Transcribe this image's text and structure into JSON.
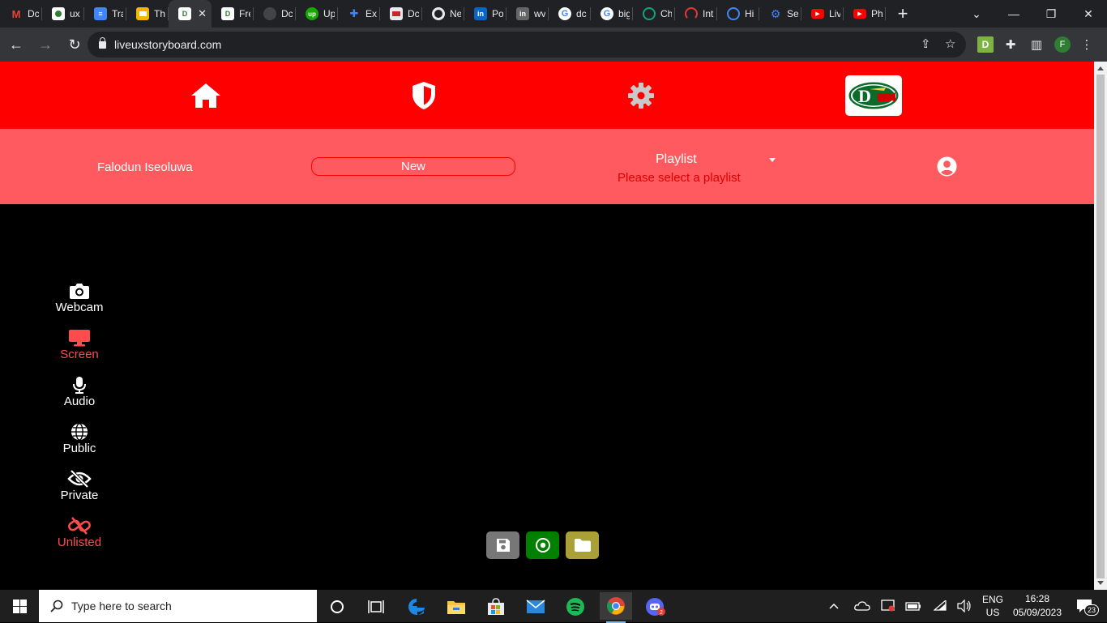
{
  "browser": {
    "tabs": [
      {
        "icon": "gmail-icon",
        "title": "Dc",
        "color": "#ea4335"
      },
      {
        "icon": "site-icon",
        "title": "ux",
        "color": "#2e7d32"
      },
      {
        "icon": "docs-icon",
        "title": "Tra",
        "color": "#4285f4"
      },
      {
        "icon": "slides-icon",
        "title": "Th",
        "color": "#f4b400"
      },
      {
        "icon": "liveux-icon",
        "title": "",
        "color": "#2e7d32",
        "active": true
      },
      {
        "icon": "liveux-icon",
        "title": "Fre",
        "color": "#2e7d32"
      },
      {
        "icon": "github-icon",
        "title": "Dc",
        "color": "#444444"
      },
      {
        "icon": "upwork-icon",
        "title": "Up",
        "color": "#14a800"
      },
      {
        "icon": "extensions-icon",
        "title": "Ex",
        "color": "#4285f4"
      },
      {
        "icon": "store-icon",
        "title": "Dc",
        "color": "#e8eaed"
      },
      {
        "icon": "chrome-icon",
        "title": "Ne",
        "color": "#e8eaed"
      },
      {
        "icon": "linkedin-icon",
        "title": "Po",
        "color": "#0a66c2"
      },
      {
        "icon": "linkedin-icon",
        "title": "wv",
        "color": "#666666"
      },
      {
        "icon": "google-icon",
        "title": "dc",
        "color": "#ffffff"
      },
      {
        "icon": "google-icon",
        "title": "big",
        "color": "#ffffff"
      },
      {
        "icon": "chatgpt-icon",
        "title": "Ch",
        "color": "#10a37f"
      },
      {
        "icon": "speed-icon",
        "title": "Int",
        "color": "#e53935"
      },
      {
        "icon": "history-icon",
        "title": "Hi",
        "color": "#4285f4"
      },
      {
        "icon": "settings-icon",
        "title": "Se",
        "color": "#4285f4"
      },
      {
        "icon": "youtube-icon",
        "title": "Liv",
        "color": "#ff0000"
      },
      {
        "icon": "youtube-icon",
        "title": "Ph",
        "color": "#ff0000"
      }
    ],
    "url": "liveuxstoryboard.com"
  },
  "app": {
    "colors": {
      "primary": "#ff0000",
      "secondary": "#ff5a5f"
    },
    "user_name": "Falodun Iseoluwa",
    "new_label": "New",
    "playlist_label": "Playlist",
    "playlist_hint": "Please select a playlist",
    "logo_text": "D",
    "sidebar": [
      {
        "name": "webcam",
        "label": "Webcam",
        "icon": "camera-icon",
        "color": "#ffffff"
      },
      {
        "name": "screen",
        "label": "Screen",
        "icon": "monitor-icon",
        "color": "#ff4b4b"
      },
      {
        "name": "audio",
        "label": "Audio",
        "icon": "microphone-icon",
        "color": "#ffffff"
      },
      {
        "name": "public",
        "label": "Public",
        "icon": "globe-icon",
        "color": "#ffffff"
      },
      {
        "name": "private",
        "label": "Private",
        "icon": "eye-slash-icon",
        "color": "#ffffff"
      },
      {
        "name": "unlisted",
        "label": "Unlisted",
        "icon": "unlink-icon",
        "color": "#ff4b4b"
      }
    ],
    "dock": [
      {
        "icon": "save-icon",
        "color": "#777777"
      },
      {
        "icon": "record-icon",
        "color": "#008000"
      },
      {
        "icon": "folder-icon",
        "color": "#a9a037"
      }
    ]
  },
  "taskbar": {
    "search_placeholder": "Type here to search",
    "language": "ENG",
    "region": "US",
    "time": "16:28",
    "date": "05/09/2023",
    "notification_count": "23"
  }
}
